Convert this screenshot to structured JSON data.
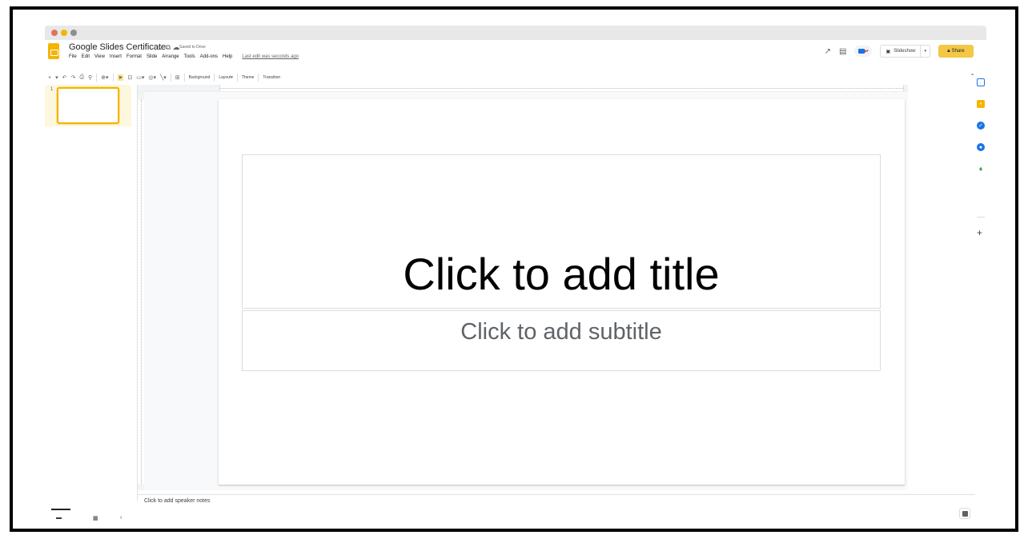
{
  "window": {
    "dot_colors": [
      "#e2725b",
      "#f4b400",
      "#8e8e8e"
    ]
  },
  "header": {
    "doc_title": "Google Slides Certificate",
    "saved_status": "Saved to Drive",
    "icons": [
      "star-icon",
      "move-to-folder-icon",
      "cloud-icon"
    ],
    "menu": [
      "File",
      "Edit",
      "View",
      "Insert",
      "Format",
      "Slide",
      "Arrange",
      "Tools",
      "Add-ons",
      "Help"
    ],
    "last_edit": "Last edit was seconds ago"
  },
  "top_right": {
    "slideshow_label": "Slideshow",
    "share_label": "Share",
    "icons": [
      "trend-icon",
      "comments-icon",
      "meet-icon"
    ]
  },
  "toolbar": {
    "background_label": "Background",
    "layout_label": "Layout",
    "theme_label": "Theme",
    "transition_label": "Transition"
  },
  "filmstrip": {
    "slide_number": "1"
  },
  "slide": {
    "title_placeholder": "Click to add title",
    "subtitle_placeholder": "Click to add subtitle"
  },
  "notes": {
    "placeholder": "Click to add speaker notes"
  },
  "side_panel": {
    "icons": [
      "calendar-icon",
      "keep-icon",
      "tasks-icon",
      "contacts-icon",
      "maps-icon"
    ],
    "icon_colors": [
      "#1a73e8",
      "#f4b400",
      "#1a73e8",
      "#1a73e8",
      "#34a853"
    ]
  },
  "colors": {
    "accent": "#f4b400",
    "share_button": "#f4c744"
  }
}
